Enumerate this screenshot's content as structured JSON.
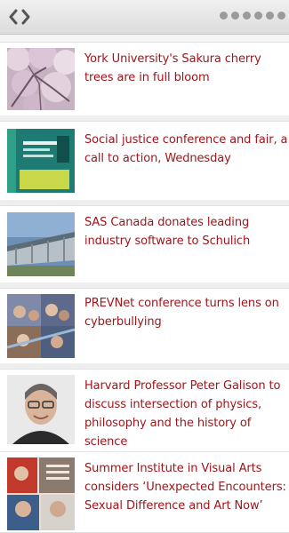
{
  "nav": {
    "prev_icon": "chevron-left-icon",
    "next_icon": "chevron-right-icon",
    "page_count": 6
  },
  "colors": {
    "link": "#a0151a",
    "toolbar": "#e4e4e4",
    "dot": "#9a9a9a"
  },
  "news": [
    {
      "title": "York University's Sakura cherry trees are in full bloom",
      "thumb": "cherry-blossom-photo"
    },
    {
      "title": "Social justice conference and fair, a call to action, Wednesday",
      "thumb": "conference-poster-image"
    },
    {
      "title": "SAS Canada donates leading industry software to Schulich",
      "thumb": "building-photo"
    },
    {
      "title": "PREVNet conference turns lens on cyberbullying",
      "thumb": "students-collage-photo"
    },
    {
      "title": "Harvard Professor Peter Galison to discuss intersection of physics, philosophy and the history of science",
      "thumb": "professor-portrait-photo"
    },
    {
      "title": "Summer Institute in Visual Arts considers ‘Unexpected Encounters: Sexual Difference and Art Now’",
      "thumb": "summer-institute-collage"
    }
  ]
}
